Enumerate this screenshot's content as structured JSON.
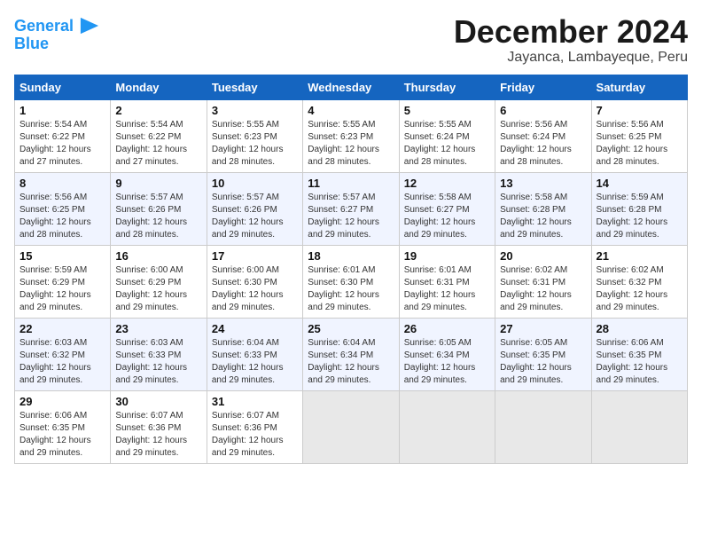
{
  "header": {
    "logo_line1": "General",
    "logo_line2": "Blue",
    "month": "December 2024",
    "location": "Jayanca, Lambayeque, Peru"
  },
  "days_of_week": [
    "Sunday",
    "Monday",
    "Tuesday",
    "Wednesday",
    "Thursday",
    "Friday",
    "Saturday"
  ],
  "weeks": [
    [
      {
        "day": "1",
        "info": "Sunrise: 5:54 AM\nSunset: 6:22 PM\nDaylight: 12 hours\nand 27 minutes."
      },
      {
        "day": "2",
        "info": "Sunrise: 5:54 AM\nSunset: 6:22 PM\nDaylight: 12 hours\nand 27 minutes."
      },
      {
        "day": "3",
        "info": "Sunrise: 5:55 AM\nSunset: 6:23 PM\nDaylight: 12 hours\nand 28 minutes."
      },
      {
        "day": "4",
        "info": "Sunrise: 5:55 AM\nSunset: 6:23 PM\nDaylight: 12 hours\nand 28 minutes."
      },
      {
        "day": "5",
        "info": "Sunrise: 5:55 AM\nSunset: 6:24 PM\nDaylight: 12 hours\nand 28 minutes."
      },
      {
        "day": "6",
        "info": "Sunrise: 5:56 AM\nSunset: 6:24 PM\nDaylight: 12 hours\nand 28 minutes."
      },
      {
        "day": "7",
        "info": "Sunrise: 5:56 AM\nSunset: 6:25 PM\nDaylight: 12 hours\nand 28 minutes."
      }
    ],
    [
      {
        "day": "8",
        "info": "Sunrise: 5:56 AM\nSunset: 6:25 PM\nDaylight: 12 hours\nand 28 minutes."
      },
      {
        "day": "9",
        "info": "Sunrise: 5:57 AM\nSunset: 6:26 PM\nDaylight: 12 hours\nand 28 minutes."
      },
      {
        "day": "10",
        "info": "Sunrise: 5:57 AM\nSunset: 6:26 PM\nDaylight: 12 hours\nand 29 minutes."
      },
      {
        "day": "11",
        "info": "Sunrise: 5:57 AM\nSunset: 6:27 PM\nDaylight: 12 hours\nand 29 minutes."
      },
      {
        "day": "12",
        "info": "Sunrise: 5:58 AM\nSunset: 6:27 PM\nDaylight: 12 hours\nand 29 minutes."
      },
      {
        "day": "13",
        "info": "Sunrise: 5:58 AM\nSunset: 6:28 PM\nDaylight: 12 hours\nand 29 minutes."
      },
      {
        "day": "14",
        "info": "Sunrise: 5:59 AM\nSunset: 6:28 PM\nDaylight: 12 hours\nand 29 minutes."
      }
    ],
    [
      {
        "day": "15",
        "info": "Sunrise: 5:59 AM\nSunset: 6:29 PM\nDaylight: 12 hours\nand 29 minutes."
      },
      {
        "day": "16",
        "info": "Sunrise: 6:00 AM\nSunset: 6:29 PM\nDaylight: 12 hours\nand 29 minutes."
      },
      {
        "day": "17",
        "info": "Sunrise: 6:00 AM\nSunset: 6:30 PM\nDaylight: 12 hours\nand 29 minutes."
      },
      {
        "day": "18",
        "info": "Sunrise: 6:01 AM\nSunset: 6:30 PM\nDaylight: 12 hours\nand 29 minutes."
      },
      {
        "day": "19",
        "info": "Sunrise: 6:01 AM\nSunset: 6:31 PM\nDaylight: 12 hours\nand 29 minutes."
      },
      {
        "day": "20",
        "info": "Sunrise: 6:02 AM\nSunset: 6:31 PM\nDaylight: 12 hours\nand 29 minutes."
      },
      {
        "day": "21",
        "info": "Sunrise: 6:02 AM\nSunset: 6:32 PM\nDaylight: 12 hours\nand 29 minutes."
      }
    ],
    [
      {
        "day": "22",
        "info": "Sunrise: 6:03 AM\nSunset: 6:32 PM\nDaylight: 12 hours\nand 29 minutes."
      },
      {
        "day": "23",
        "info": "Sunrise: 6:03 AM\nSunset: 6:33 PM\nDaylight: 12 hours\nand 29 minutes."
      },
      {
        "day": "24",
        "info": "Sunrise: 6:04 AM\nSunset: 6:33 PM\nDaylight: 12 hours\nand 29 minutes."
      },
      {
        "day": "25",
        "info": "Sunrise: 6:04 AM\nSunset: 6:34 PM\nDaylight: 12 hours\nand 29 minutes."
      },
      {
        "day": "26",
        "info": "Sunrise: 6:05 AM\nSunset: 6:34 PM\nDaylight: 12 hours\nand 29 minutes."
      },
      {
        "day": "27",
        "info": "Sunrise: 6:05 AM\nSunset: 6:35 PM\nDaylight: 12 hours\nand 29 minutes."
      },
      {
        "day": "28",
        "info": "Sunrise: 6:06 AM\nSunset: 6:35 PM\nDaylight: 12 hours\nand 29 minutes."
      }
    ],
    [
      {
        "day": "29",
        "info": "Sunrise: 6:06 AM\nSunset: 6:35 PM\nDaylight: 12 hours\nand 29 minutes."
      },
      {
        "day": "30",
        "info": "Sunrise: 6:07 AM\nSunset: 6:36 PM\nDaylight: 12 hours\nand 29 minutes."
      },
      {
        "day": "31",
        "info": "Sunrise: 6:07 AM\nSunset: 6:36 PM\nDaylight: 12 hours\nand 29 minutes."
      },
      {
        "day": "",
        "info": ""
      },
      {
        "day": "",
        "info": ""
      },
      {
        "day": "",
        "info": ""
      },
      {
        "day": "",
        "info": ""
      }
    ]
  ]
}
